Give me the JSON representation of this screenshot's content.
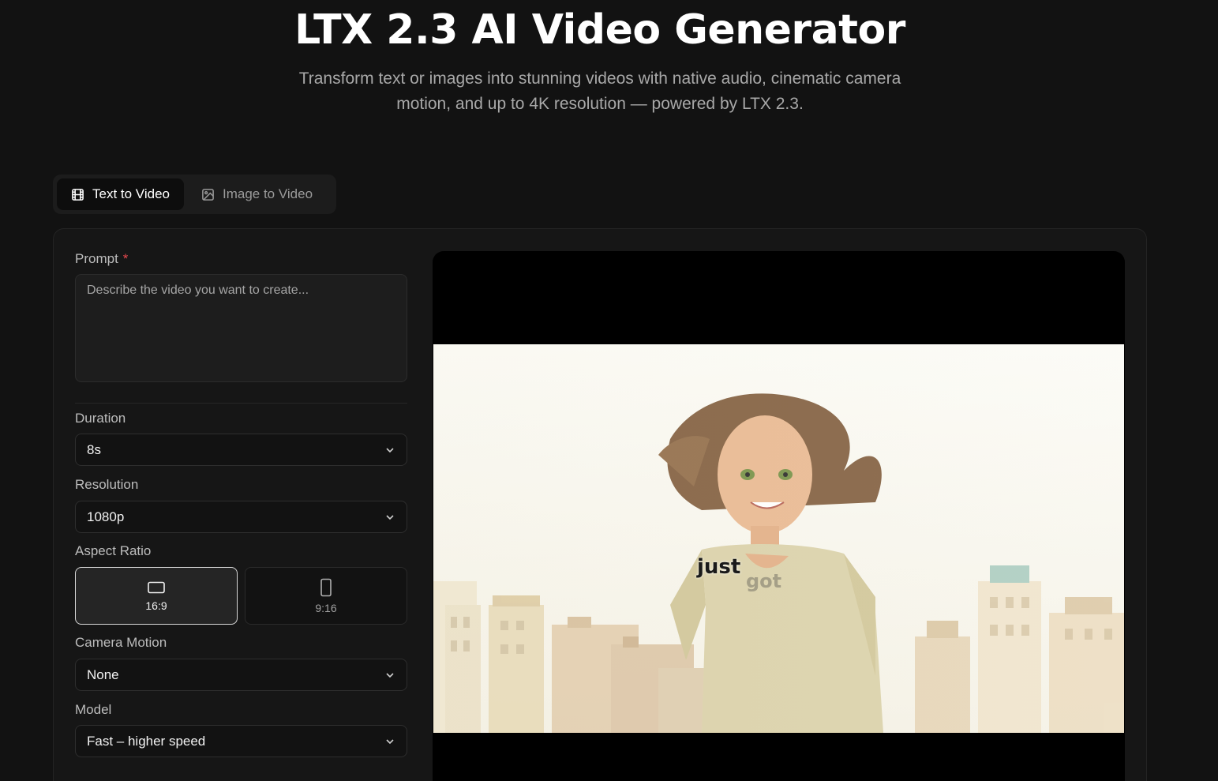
{
  "hero": {
    "title": "LTX 2.3 AI Video Generator",
    "subtitle": "Transform text or images into stunning videos with native audio, cinematic camera motion, and up to 4K resolution — powered by LTX 2.3."
  },
  "tabs": [
    {
      "label": "Text to Video",
      "icon": "film-icon",
      "active": true
    },
    {
      "label": "Image to Video",
      "icon": "image-icon",
      "active": false
    }
  ],
  "form": {
    "prompt_label": "Prompt",
    "prompt_required": "*",
    "prompt_placeholder": "Describe the video you want to create...",
    "duration_label": "Duration",
    "duration_value": "8s",
    "resolution_label": "Resolution",
    "resolution_value": "1080p",
    "aspect_label": "Aspect Ratio",
    "aspect_options": [
      {
        "label": "16:9",
        "icon": "landscape-icon",
        "selected": true
      },
      {
        "label": "9:16",
        "icon": "portrait-icon",
        "selected": false
      }
    ],
    "camera_label": "Camera Motion",
    "camera_value": "None",
    "model_label": "Model",
    "model_value": "Fast – higher speed"
  },
  "preview": {
    "caption_primary": "just",
    "caption_secondary": "got"
  },
  "colors": {
    "background": "#121212",
    "card": "#161616",
    "required": "#e5484d"
  }
}
